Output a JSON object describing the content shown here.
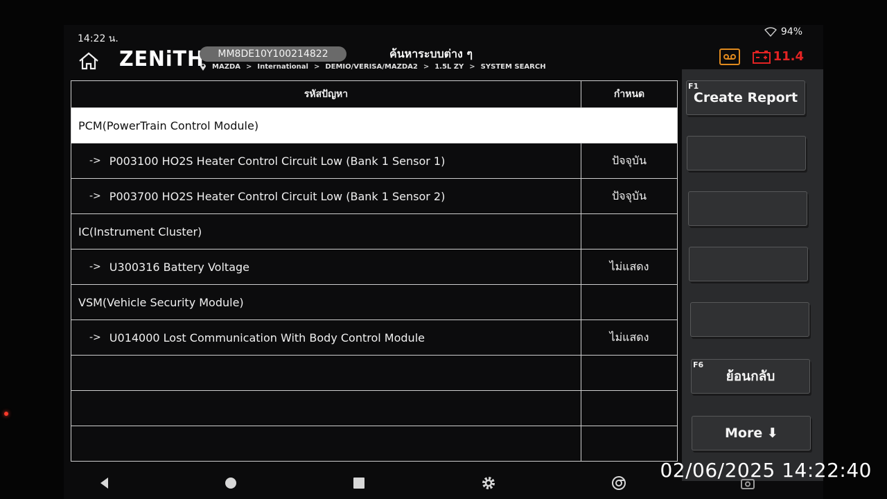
{
  "status_bar": {
    "time": "14:22 น.",
    "battery": "94%"
  },
  "header": {
    "logo": "ZENiTH",
    "vin": "MM8DE10Y100214822",
    "title": "ค้นหาระบบต่าง ๆ",
    "breadcrumb": [
      "MAZDA",
      "International",
      "DEMIO/VERISA/MAZDA2",
      "1.5L ZY",
      "SYSTEM SEARCH"
    ],
    "battery_voltage": "11.4"
  },
  "table": {
    "headers": [
      "รหัสปัญหา",
      "กำหนด"
    ],
    "rows": [
      {
        "type": "group",
        "text": "PCM(PowerTrain Control Module)",
        "status": "",
        "selected": true
      },
      {
        "type": "code",
        "arrow": "->",
        "text": "P003100 HO2S Heater Control Circuit Low (Bank 1 Sensor 1)",
        "status": "ปัจจุบัน"
      },
      {
        "type": "code",
        "arrow": "->",
        "text": "P003700 HO2S Heater Control Circuit Low (Bank 1 Sensor 2)",
        "status": "ปัจจุบัน"
      },
      {
        "type": "group",
        "text": "IC(Instrument Cluster)",
        "status": ""
      },
      {
        "type": "code",
        "arrow": "->",
        "text": "U300316 Battery Voltage",
        "status": "ไม่แสดง"
      },
      {
        "type": "group",
        "text": "VSM(Vehicle Security Module)",
        "status": ""
      },
      {
        "type": "code",
        "arrow": "->",
        "text": "U014000 Lost Communication With Body Control Module",
        "status": "ไม่แสดง"
      },
      {
        "type": "empty",
        "text": "",
        "status": ""
      },
      {
        "type": "empty",
        "text": "",
        "status": ""
      },
      {
        "type": "empty",
        "text": "",
        "status": ""
      }
    ]
  },
  "side_panel": {
    "buttons": [
      {
        "fkey": "F1",
        "label": "Create Report"
      },
      {
        "fkey": "",
        "label": ""
      },
      {
        "fkey": "",
        "label": ""
      },
      {
        "fkey": "",
        "label": ""
      },
      {
        "fkey": "",
        "label": ""
      },
      {
        "fkey": "F6",
        "label": "ย้อนกลับ"
      },
      {
        "fkey": "",
        "label": "More ⬇"
      }
    ]
  },
  "nav_bar": {
    "icons": [
      "back-icon",
      "home-circle-icon",
      "recents-icon",
      "settings-gear-icon",
      "browser-icon",
      "screenshot-icon"
    ]
  },
  "overlay": {
    "timestamp": "02/06/2025 14:22:40"
  },
  "colors": {
    "accent_orange": "#e08a1e",
    "battery_red": "#e32323",
    "panel_bg": "#2a2b2d",
    "selected_row": "#ffffff"
  }
}
